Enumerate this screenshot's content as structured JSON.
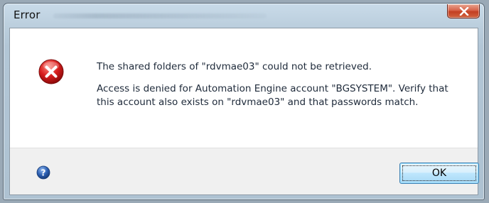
{
  "window": {
    "title": "Error",
    "close_icon": "close-icon"
  },
  "message": {
    "icon": "error-icon",
    "main": "The shared folders of \"rdvmae03\" could not be retrieved.",
    "detail": "Access is denied for Automation Engine account \"BGSYSTEM\". Verify that this account also exists on \"rdvmae03\" and that passwords match."
  },
  "footer": {
    "help_icon": "help-icon",
    "ok_label": "OK"
  },
  "colors": {
    "error_red": "#c8102e",
    "close_button": "#c33f22",
    "button_border": "#3c7fb1",
    "help_blue": "#2a5db0"
  }
}
